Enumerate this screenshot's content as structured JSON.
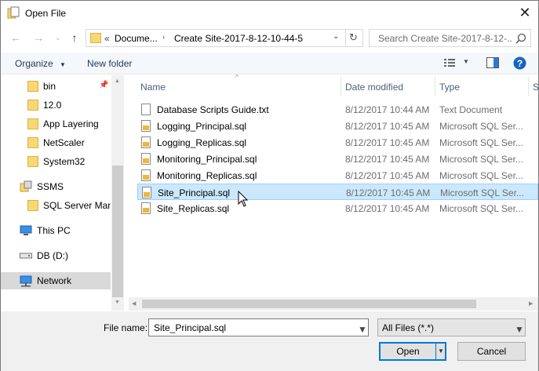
{
  "window": {
    "title": "Open File"
  },
  "address": {
    "overflow": "«",
    "crumb1": "Docume...",
    "crumb2": "Create Site-2017-8-12-10-44-5",
    "search_placeholder": "Search Create Site-2017-8-12-..."
  },
  "toolbar": {
    "organize": "Organize",
    "new_folder": "New folder"
  },
  "nav": {
    "items": [
      {
        "label": "bin",
        "kind": "folder",
        "pinned": true
      },
      {
        "label": "12.0",
        "kind": "folder"
      },
      {
        "label": "App Layering",
        "kind": "folder"
      },
      {
        "label": "NetScaler",
        "kind": "folder"
      },
      {
        "label": "System32",
        "kind": "folder"
      },
      {
        "label": "SSMS",
        "kind": "app"
      },
      {
        "label": "SQL Server Mana",
        "kind": "folder"
      },
      {
        "label": "This PC",
        "kind": "pc"
      },
      {
        "label": "DB (D:)",
        "kind": "drive"
      },
      {
        "label": "Network",
        "kind": "network",
        "selected": true
      }
    ]
  },
  "columns": {
    "name": "Name",
    "date": "Date modified",
    "type": "Type",
    "size": "S"
  },
  "files": [
    {
      "name": "Database Scripts Guide.txt",
      "date": "8/12/2017 10:44 AM",
      "type": "Text Document",
      "icon": "text-file-icon"
    },
    {
      "name": "Logging_Principal.sql",
      "date": "8/12/2017 10:45 AM",
      "type": "Microsoft SQL Ser...",
      "icon": "sql-file-icon"
    },
    {
      "name": "Logging_Replicas.sql",
      "date": "8/12/2017 10:45 AM",
      "type": "Microsoft SQL Ser...",
      "icon": "sql-file-icon"
    },
    {
      "name": "Monitoring_Principal.sql",
      "date": "8/12/2017 10:45 AM",
      "type": "Microsoft SQL Ser...",
      "icon": "sql-file-icon"
    },
    {
      "name": "Monitoring_Replicas.sql",
      "date": "8/12/2017 10:45 AM",
      "type": "Microsoft SQL Ser...",
      "icon": "sql-file-icon"
    },
    {
      "name": "Site_Principal.sql",
      "date": "8/12/2017 10:45 AM",
      "type": "Microsoft SQL Ser...",
      "icon": "sql-file-icon",
      "selected": true
    },
    {
      "name": "Site_Replicas.sql",
      "date": "8/12/2017 10:45 AM",
      "type": "Microsoft SQL Ser...",
      "icon": "sql-file-icon"
    }
  ],
  "footer": {
    "filename_label": "File name:",
    "filename_value": "Site_Principal.sql",
    "filter_value": "All Files (*.*)",
    "open_label": "Open",
    "cancel_label": "Cancel"
  },
  "colors": {
    "accent": "#0078d7",
    "selection": "#cce8ff",
    "help": "#1565c0"
  }
}
